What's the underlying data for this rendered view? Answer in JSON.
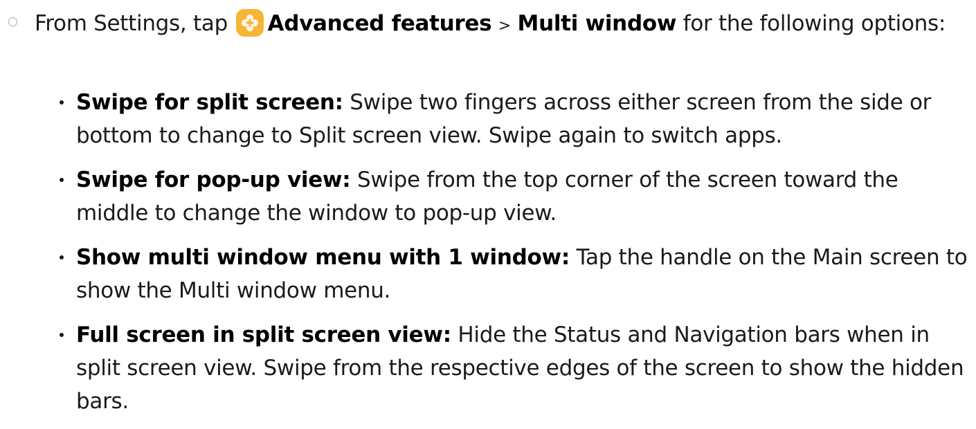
{
  "step": {
    "prefix": "From Settings, tap",
    "icon": "advanced-features-plus-icon",
    "icon_color": "#f7b535",
    "advanced_features": "Advanced features",
    "separator": ">",
    "multi_window": "Multi window",
    "suffix": "for the following options:"
  },
  "options": [
    {
      "title": "Swipe for split screen",
      "colon": ":",
      "description": "Swipe two fingers across either screen from the side or bottom to change to Split screen view. Swipe again to switch apps."
    },
    {
      "title": "Swipe for pop-up view",
      "colon": ":",
      "description": "Swipe from the top corner of the screen toward the middle to change the window to pop-up view."
    },
    {
      "title": "Show multi window menu with 1 window",
      "colon": ":",
      "description": "Tap the handle on the Main screen to show the Multi window menu."
    },
    {
      "title": "Full screen in split screen view",
      "colon": ":",
      "description": "Hide the Status and Navigation bars when in split screen view. Swipe from the respective edges of the screen to show the hidden bars."
    }
  ]
}
